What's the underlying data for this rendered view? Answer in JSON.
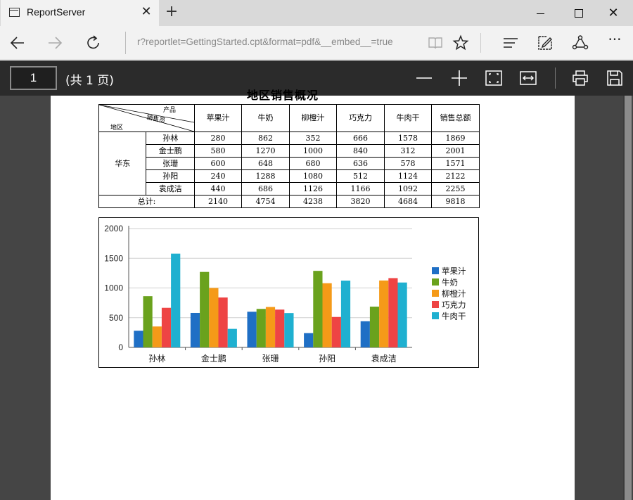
{
  "browser": {
    "tab_title": "ReportServer",
    "tab_close": "✕",
    "new_tab": "+",
    "window_close": "✕",
    "more": "···",
    "address": "r?reportlet=GettingStarted.cpt&format=pdf&__embed__=true"
  },
  "pdf_toolbar": {
    "page_number": "1",
    "page_total": "(共 1 页)"
  },
  "report": {
    "title": "地区销售概况",
    "header": {
      "product_label": "产品",
      "sales_label": "销售员",
      "region_label": "地区",
      "columns": [
        "苹果汁",
        "牛奶",
        "柳橙汁",
        "巧克力",
        "牛肉干",
        "销售总额"
      ]
    },
    "region": "华东",
    "rows": [
      {
        "name": "孙林",
        "values": [
          "280",
          "862",
          "352",
          "666",
          "1578",
          "1869"
        ]
      },
      {
        "name": "金士鹏",
        "values": [
          "580",
          "1270",
          "1000",
          "840",
          "312",
          "2001"
        ]
      },
      {
        "name": "张珊",
        "values": [
          "600",
          "648",
          "680",
          "636",
          "578",
          "1571"
        ]
      },
      {
        "name": "孙阳",
        "values": [
          "240",
          "1288",
          "1080",
          "512",
          "1124",
          "2122"
        ]
      },
      {
        "name": "袁成洁",
        "values": [
          "440",
          "686",
          "1126",
          "1166",
          "1092",
          "2255"
        ]
      }
    ],
    "total": {
      "label": "总计:",
      "values": [
        "2140",
        "4754",
        "4238",
        "3820",
        "4684",
        "9818"
      ]
    }
  },
  "chart_data": {
    "type": "bar",
    "categories": [
      "孙林",
      "金士鹏",
      "张珊",
      "孙阳",
      "袁成洁"
    ],
    "series": [
      {
        "name": "苹果汁",
        "color": "#1f6fc5",
        "values": [
          280,
          580,
          600,
          240,
          440
        ]
      },
      {
        "name": "牛奶",
        "color": "#6aa21d",
        "values": [
          862,
          1270,
          648,
          1288,
          686
        ]
      },
      {
        "name": "柳橙汁",
        "color": "#f59a18",
        "values": [
          352,
          1000,
          680,
          1080,
          1126
        ]
      },
      {
        "name": "巧克力",
        "color": "#ee4444",
        "values": [
          666,
          840,
          636,
          512,
          1166
        ]
      },
      {
        "name": "牛肉干",
        "color": "#1fb0d0",
        "values": [
          1578,
          312,
          578,
          1124,
          1092
        ]
      }
    ],
    "ylim": [
      0,
      2000
    ],
    "yticks": [
      0,
      500,
      1000,
      1500,
      2000
    ],
    "ytick_labels": [
      "0",
      "500",
      "1000",
      "1500",
      "2000"
    ],
    "grid": true,
    "legend_position": "right"
  }
}
